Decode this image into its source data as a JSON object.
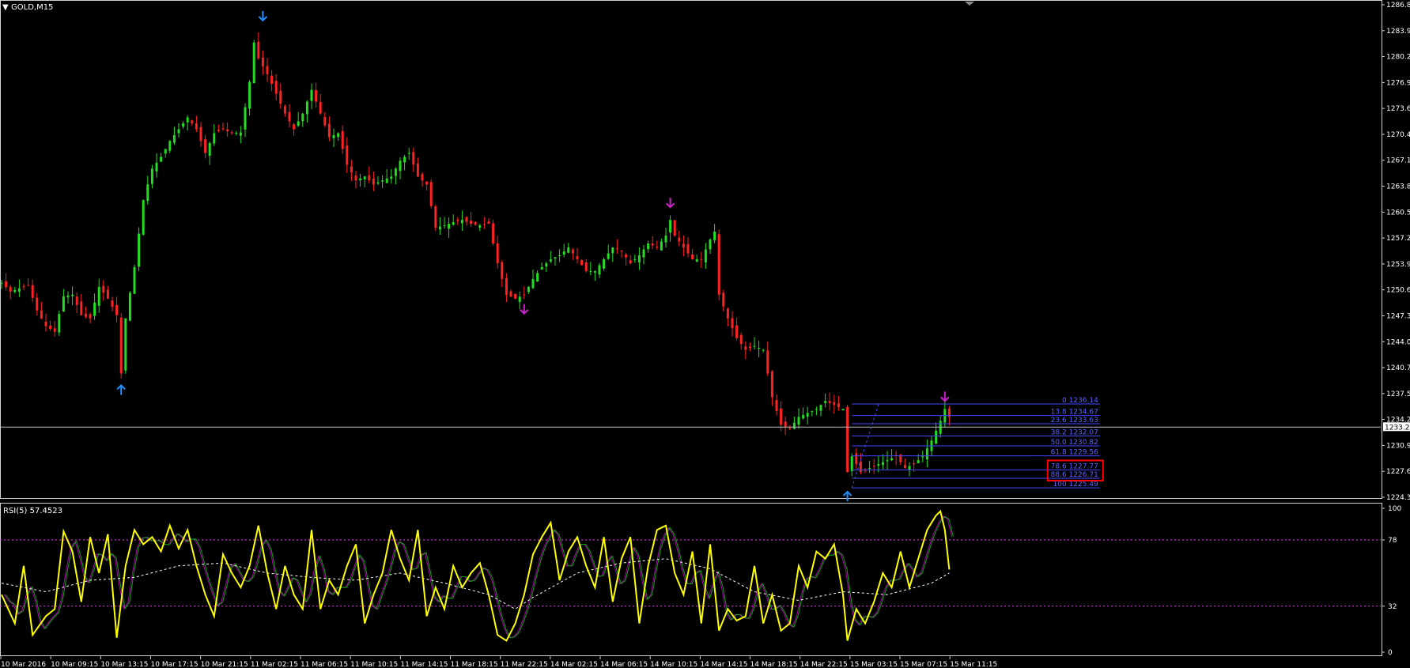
{
  "window": {
    "title": "GOLD,M15"
  },
  "colors": {
    "background": "#000000",
    "bull": "#22dd22",
    "bear": "#ff2222",
    "axis": "#cfcfcf",
    "fib": "#4646ff",
    "fractal_low": "#1e90ff",
    "fractal_high": "#cc22cc",
    "rsi": "#ffff00",
    "rsi_signal": "#00aa00",
    "rsi_signal2": "#aa00aa",
    "rsi_ma": "#ffffff",
    "level_line": "#ff33ff",
    "highlight_box": "#ff0000"
  },
  "chart_data": [
    {
      "type": "candlestick",
      "title": "GOLD,M15",
      "symbol": "GOLD",
      "timeframe": "M15",
      "y_range": [
        1224.3,
        1286.8
      ],
      "y_ticks": [
        "1286.8",
        "1283.9",
        "1280.2",
        "1276.9",
        "1273.6",
        "1270.4",
        "1267.1",
        "1263.8",
        "1260.5",
        "1257.2",
        "1253.9",
        "1250.6",
        "1247.3",
        "1244.0",
        "1240.7",
        "1237.5",
        "1234.2",
        "1230.9",
        "1227.6",
        "1224.3"
      ],
      "current_price": "1233.2",
      "x_ticks": [
        "10 Mar 2016",
        "10 Mar 09:15",
        "10 Mar 13:15",
        "10 Mar 17:15",
        "10 Mar 21:15",
        "11 Mar 02:15",
        "11 Mar 06:15",
        "11 Mar 10:15",
        "11 Mar 14:15",
        "11 Mar 18:15",
        "11 Mar 22:15",
        "14 Mar 02:15",
        "14 Mar 06:15",
        "14 Mar 10:15",
        "14 Mar 14:15",
        "14 Mar 18:15",
        "14 Mar 22:15",
        "15 Mar 03:15",
        "15 Mar 07:15",
        "15 Mar 11:15"
      ],
      "price_path": [
        [
          0,
          1251.5
        ],
        [
          2,
          1250.4
        ],
        [
          4,
          1250.8
        ],
        [
          6,
          1251.2
        ],
        [
          8,
          1248.0
        ],
        [
          10,
          1246.0
        ],
        [
          12,
          1245.3
        ],
        [
          14,
          1249.8
        ],
        [
          16,
          1250.0
        ],
        [
          18,
          1247.4
        ],
        [
          20,
          1247.0
        ],
        [
          22,
          1251.0
        ],
        [
          24,
          1249.5
        ],
        [
          26,
          1247.4
        ],
        [
          27,
          1240.0
        ],
        [
          28,
          1247.0
        ],
        [
          30,
          1253.5
        ],
        [
          32,
          1262.0
        ],
        [
          34,
          1266.0
        ],
        [
          36,
          1267.5
        ],
        [
          38,
          1269.5
        ],
        [
          40,
          1271.0
        ],
        [
          42,
          1272.5
        ],
        [
          44,
          1271.0
        ],
        [
          46,
          1268.0
        ],
        [
          48,
          1270.5
        ],
        [
          50,
          1271.0
        ],
        [
          52,
          1270.5
        ],
        [
          54,
          1270.6
        ],
        [
          56,
          1277.0
        ],
        [
          57,
          1282.0
        ],
        [
          58,
          1280.0
        ],
        [
          60,
          1278.0
        ],
        [
          62,
          1275.5
        ],
        [
          64,
          1273.0
        ],
        [
          66,
          1271.0
        ],
        [
          68,
          1273.0
        ],
        [
          70,
          1276.0
        ],
        [
          72,
          1273.0
        ],
        [
          74,
          1270.0
        ],
        [
          76,
          1270.5
        ],
        [
          78,
          1266.5
        ],
        [
          80,
          1264.5
        ],
        [
          82,
          1265.0
        ],
        [
          84,
          1264.0
        ],
        [
          86,
          1264.5
        ],
        [
          88,
          1265.0
        ],
        [
          90,
          1267.0
        ],
        [
          92,
          1268.0
        ],
        [
          94,
          1265.0
        ],
        [
          96,
          1264.0
        ],
        [
          98,
          1258.5
        ],
        [
          100,
          1258.8
        ],
        [
          102,
          1259.2
        ],
        [
          104,
          1259.5
        ],
        [
          106,
          1259.0
        ],
        [
          108,
          1258.8
        ],
        [
          110,
          1259.0
        ],
        [
          112,
          1254.0
        ],
        [
          114,
          1250.0
        ],
        [
          116,
          1249.5
        ],
        [
          118,
          1250.0
        ],
        [
          120,
          1252.0
        ],
        [
          122,
          1253.5
        ],
        [
          124,
          1254.5
        ],
        [
          126,
          1255.0
        ],
        [
          128,
          1256.0
        ],
        [
          130,
          1254.5
        ],
        [
          132,
          1253.0
        ],
        [
          134,
          1253.0
        ],
        [
          136,
          1254.5
        ],
        [
          138,
          1256.0
        ],
        [
          140,
          1255.5
        ],
        [
          142,
          1254.0
        ],
        [
          144,
          1255.0
        ],
        [
          146,
          1256.5
        ],
        [
          148,
          1256.0
        ],
        [
          150,
          1257.5
        ],
        [
          151,
          1259.5
        ],
        [
          152,
          1257.5
        ],
        [
          154,
          1256.0
        ],
        [
          156,
          1254.5
        ],
        [
          158,
          1254.5
        ],
        [
          160,
          1257.0
        ],
        [
          161,
          1258.0
        ],
        [
          162,
          1250.0
        ],
        [
          164,
          1247.0
        ],
        [
          166,
          1244.5
        ],
        [
          168,
          1243.0
        ],
        [
          170,
          1243.5
        ],
        [
          172,
          1243.0
        ],
        [
          174,
          1237.0
        ],
        [
          176,
          1233.5
        ],
        [
          178,
          1233.0
        ],
        [
          180,
          1234.5
        ],
        [
          182,
          1235.0
        ],
        [
          184,
          1235.5
        ],
        [
          186,
          1236.5
        ],
        [
          188,
          1236.0
        ],
        [
          190,
          1235.5
        ],
        [
          191,
          1227.5
        ],
        [
          192,
          1229.5
        ],
        [
          194,
          1227.5
        ],
        [
          196,
          1228.0
        ],
        [
          198,
          1228.5
        ],
        [
          200,
          1229.0
        ],
        [
          202,
          1229.5
        ],
        [
          204,
          1228.0
        ],
        [
          206,
          1228.5
        ],
        [
          208,
          1229.5
        ],
        [
          210,
          1231.5
        ],
        [
          212,
          1234.0
        ],
        [
          213,
          1235.5
        ],
        [
          214,
          1234.5
        ]
      ],
      "total_bars": 215,
      "fractals": [
        {
          "bar": 27,
          "price": 1238.5,
          "kind": "low"
        },
        {
          "bar": 59,
          "price": 1284.8,
          "kind": "high_blue"
        },
        {
          "bar": 118,
          "price": 1247.6,
          "kind": "high"
        },
        {
          "bar": 151,
          "price": 1261.1,
          "kind": "high"
        },
        {
          "bar": 191,
          "price": 1225.0,
          "kind": "low"
        },
        {
          "bar": 213,
          "price": 1236.5,
          "kind": "high"
        }
      ],
      "fib_levels": [
        {
          "label": "0 1236.14",
          "price": 1236.14
        },
        {
          "label": "13.8 1234.67",
          "price": 1234.67
        },
        {
          "label": "23.6 1233.63",
          "price": 1233.63
        },
        {
          "label": "38.2 1232.07",
          "price": 1232.07
        },
        {
          "label": "50.0 1230.82",
          "price": 1230.82
        },
        {
          "label": "61.8 1229.56",
          "price": 1229.56
        },
        {
          "label": "78.6 1227.77",
          "price": 1227.77
        },
        {
          "label": "88.6 1226.71",
          "price": 1226.71
        },
        {
          "label": "100 1225.49",
          "price": 1225.49
        }
      ],
      "fib_start_bar": 192,
      "fib_end_bar": 248,
      "highlight_levels": [
        "78.6",
        "88.6"
      ]
    },
    {
      "type": "line",
      "title": "RSI(5) 57.4523",
      "y_range": [
        0,
        100
      ],
      "y_ticks": [
        "100",
        "78",
        "32",
        "0"
      ],
      "levels": [
        78,
        32
      ],
      "rsi_path": [
        [
          0,
          40
        ],
        [
          3,
          20
        ],
        [
          5,
          60
        ],
        [
          7,
          12
        ],
        [
          10,
          25
        ],
        [
          12,
          30
        ],
        [
          14,
          84
        ],
        [
          16,
          70
        ],
        [
          18,
          35
        ],
        [
          20,
          80
        ],
        [
          22,
          55
        ],
        [
          24,
          82
        ],
        [
          26,
          10
        ],
        [
          28,
          60
        ],
        [
          30,
          85
        ],
        [
          32,
          75
        ],
        [
          34,
          80
        ],
        [
          36,
          70
        ],
        [
          38,
          88
        ],
        [
          40,
          72
        ],
        [
          42,
          85
        ],
        [
          44,
          60
        ],
        [
          46,
          40
        ],
        [
          48,
          25
        ],
        [
          50,
          68
        ],
        [
          52,
          55
        ],
        [
          54,
          45
        ],
        [
          56,
          60
        ],
        [
          58,
          88
        ],
        [
          60,
          55
        ],
        [
          62,
          30
        ],
        [
          64,
          60
        ],
        [
          66,
          40
        ],
        [
          68,
          30
        ],
        [
          70,
          85
        ],
        [
          72,
          30
        ],
        [
          74,
          50
        ],
        [
          76,
          40
        ],
        [
          78,
          60
        ],
        [
          80,
          75
        ],
        [
          82,
          20
        ],
        [
          84,
          40
        ],
        [
          86,
          55
        ],
        [
          88,
          85
        ],
        [
          90,
          65
        ],
        [
          92,
          50
        ],
        [
          94,
          85
        ],
        [
          96,
          25
        ],
        [
          98,
          45
        ],
        [
          100,
          30
        ],
        [
          102,
          60
        ],
        [
          104,
          45
        ],
        [
          106,
          55
        ],
        [
          108,
          62
        ],
        [
          110,
          40
        ],
        [
          112,
          12
        ],
        [
          114,
          8
        ],
        [
          116,
          20
        ],
        [
          118,
          40
        ],
        [
          120,
          68
        ],
        [
          122,
          80
        ],
        [
          124,
          90
        ],
        [
          126,
          50
        ],
        [
          128,
          70
        ],
        [
          130,
          80
        ],
        [
          132,
          60
        ],
        [
          134,
          45
        ],
        [
          136,
          80
        ],
        [
          138,
          35
        ],
        [
          140,
          65
        ],
        [
          142,
          80
        ],
        [
          144,
          20
        ],
        [
          146,
          60
        ],
        [
          148,
          85
        ],
        [
          150,
          88
        ],
        [
          152,
          55
        ],
        [
          154,
          40
        ],
        [
          156,
          70
        ],
        [
          158,
          20
        ],
        [
          160,
          75
        ],
        [
          162,
          15
        ],
        [
          164,
          30
        ],
        [
          166,
          22
        ],
        [
          168,
          25
        ],
        [
          170,
          60
        ],
        [
          172,
          20
        ],
        [
          174,
          40
        ],
        [
          176,
          15
        ],
        [
          178,
          20
        ],
        [
          180,
          60
        ],
        [
          182,
          45
        ],
        [
          184,
          70
        ],
        [
          186,
          65
        ],
        [
          188,
          75
        ],
        [
          190,
          40
        ],
        [
          191,
          8
        ],
        [
          193,
          30
        ],
        [
          195,
          20
        ],
        [
          197,
          35
        ],
        [
          199,
          55
        ],
        [
          201,
          45
        ],
        [
          203,
          70
        ],
        [
          205,
          45
        ],
        [
          207,
          65
        ],
        [
          209,
          85
        ],
        [
          211,
          95
        ],
        [
          212,
          98
        ],
        [
          213,
          85
        ],
        [
          214,
          57.45
        ]
      ],
      "ma_path": [
        [
          0,
          48
        ],
        [
          10,
          42
        ],
        [
          20,
          50
        ],
        [
          30,
          52
        ],
        [
          40,
          60
        ],
        [
          50,
          62
        ],
        [
          60,
          55
        ],
        [
          70,
          52
        ],
        [
          80,
          50
        ],
        [
          90,
          55
        ],
        [
          100,
          48
        ],
        [
          110,
          40
        ],
        [
          116,
          30
        ],
        [
          120,
          38
        ],
        [
          130,
          55
        ],
        [
          140,
          62
        ],
        [
          150,
          65
        ],
        [
          160,
          58
        ],
        [
          170,
          42
        ],
        [
          180,
          36
        ],
        [
          190,
          42
        ],
        [
          200,
          40
        ],
        [
          210,
          48
        ],
        [
          214,
          55
        ]
      ],
      "total_bars": 215
    }
  ]
}
